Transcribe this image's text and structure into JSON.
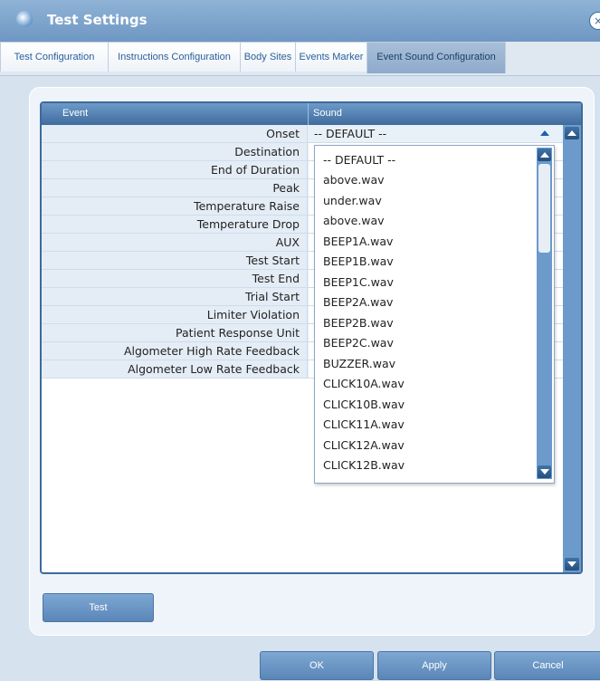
{
  "window": {
    "title": "Test Settings"
  },
  "tabs": [
    {
      "label": "Test Configuration"
    },
    {
      "label": "Instructions Configuration"
    },
    {
      "label": "Body Sites"
    },
    {
      "label": "Events Marker"
    },
    {
      "label": "Event Sound Configuration",
      "active": true
    }
  ],
  "grid": {
    "headers": {
      "event": "Event",
      "sound": "Sound"
    },
    "rows": [
      {
        "event": "Onset",
        "sound": "-- DEFAULT --"
      },
      {
        "event": "Destination",
        "sound": ""
      },
      {
        "event": "End of Duration",
        "sound": ""
      },
      {
        "event": "Peak",
        "sound": ""
      },
      {
        "event": "Temperature Raise",
        "sound": ""
      },
      {
        "event": "Temperature Drop",
        "sound": ""
      },
      {
        "event": "AUX",
        "sound": ""
      },
      {
        "event": "Test Start",
        "sound": ""
      },
      {
        "event": "Test End",
        "sound": ""
      },
      {
        "event": "Trial Start",
        "sound": ""
      },
      {
        "event": "Limiter Violation",
        "sound": ""
      },
      {
        "event": "Patient Response Unit",
        "sound": ""
      },
      {
        "event": "Algometer High Rate Feedback",
        "sound": ""
      },
      {
        "event": "Algometer Low Rate Feedback",
        "sound": ""
      }
    ]
  },
  "dropdown": {
    "options": [
      "-- DEFAULT --",
      "above.wav",
      "under.wav",
      "above.wav",
      "BEEP1A.wav",
      "BEEP1B.wav",
      "BEEP1C.wav",
      "BEEP2A.wav",
      "BEEP2B.wav",
      "BEEP2C.wav",
      "BUZZER.wav",
      "CLICK10A.wav",
      "CLICK10B.wav",
      "CLICK11A.wav",
      "CLICK12A.wav",
      "CLICK12B.wav"
    ]
  },
  "buttons": {
    "test": "Test",
    "ok": "OK",
    "apply": "Apply",
    "cancel": "Cancel"
  },
  "colors": {
    "accent": "#5a86b8",
    "header": "#3f6c9e",
    "tab_active": "#8eaacb",
    "scrollbar": "#6b9acb"
  }
}
